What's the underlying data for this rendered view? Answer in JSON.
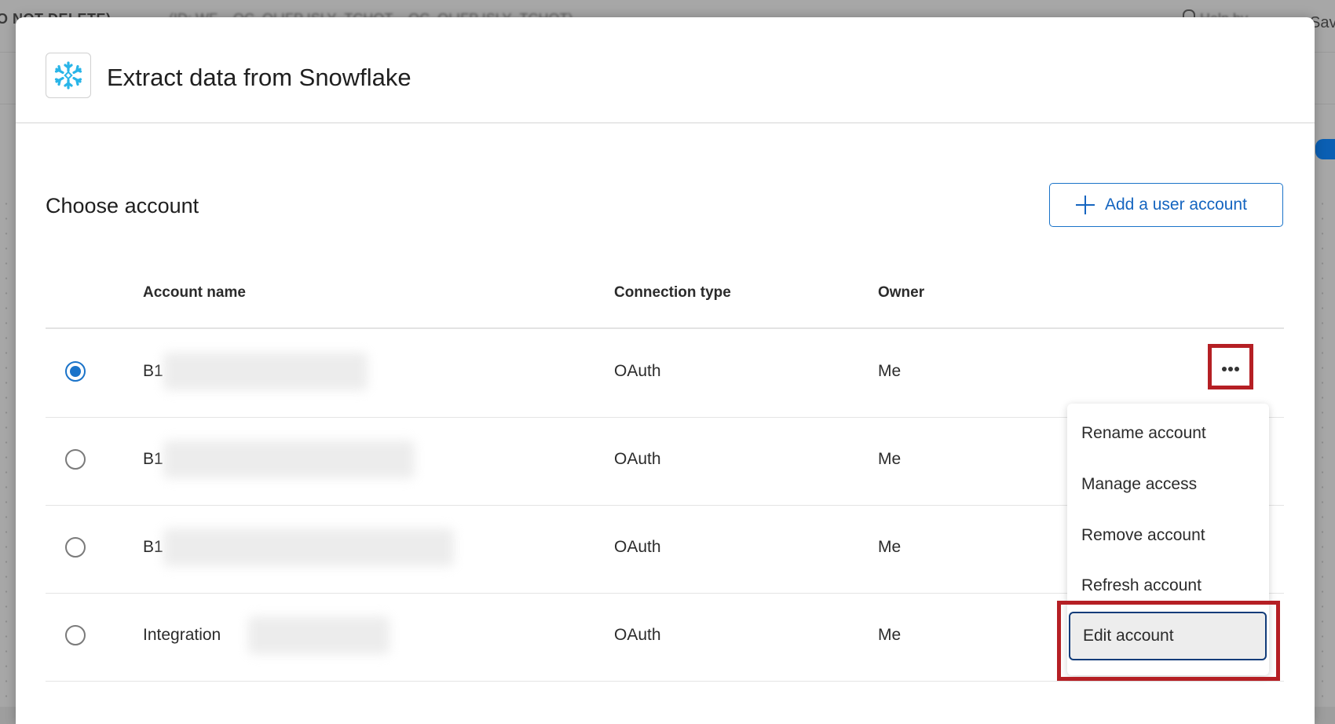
{
  "background": {
    "title_fragment": "O NOT DELETE)",
    "id_fragment": "(ID: WF__OC_QLIFP ISLY_TCHOT  ...OC_QLIFP ISLY_TCHOT)",
    "user_fragment": "Help  by",
    "save_label": "Sav"
  },
  "modal": {
    "title": "Extract data from Snowflake",
    "logo_icon": "snowflake-icon",
    "section_title": "Choose account",
    "add_button_label": "Add a user account",
    "table": {
      "columns": [
        "Account name",
        "Connection type",
        "Owner"
      ],
      "rows": [
        {
          "name": "B1",
          "connection": "OAuth",
          "owner": "Me",
          "selected": true
        },
        {
          "name": "B1",
          "connection": "OAuth",
          "owner": "Me",
          "selected": false
        },
        {
          "name": "B1",
          "connection": "OAuth",
          "owner": "Me",
          "selected": false
        },
        {
          "name": "Integration",
          "connection": "OAuth",
          "owner": "Me",
          "selected": false
        }
      ]
    },
    "menu": {
      "items": [
        "Rename account",
        "Manage access",
        "Remove account",
        "Refresh account",
        "Edit account"
      ]
    }
  },
  "colors": {
    "accent": "#1a73c9",
    "highlight_red": "#b51f24",
    "snowflake": "#29b5e8"
  }
}
